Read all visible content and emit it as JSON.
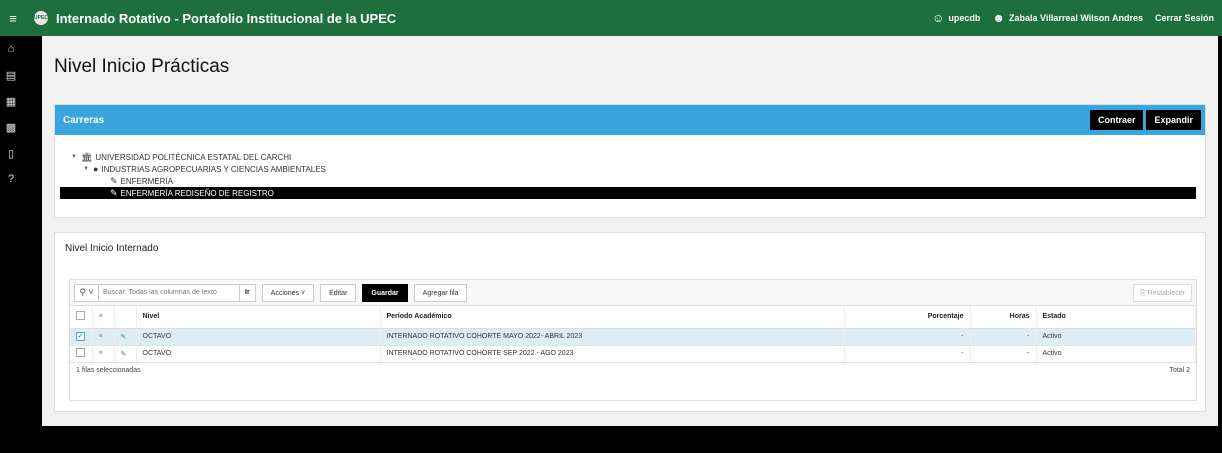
{
  "header": {
    "title": "Internado Rotativo - Portafolio Institucional de la UPEC",
    "logo_text": "UPEC",
    "user": "upecdb",
    "full_name": "Zabala Villarreal Wilson Andres",
    "logout": "Cerrar Sesión"
  },
  "sidebar": {
    "items": [
      {
        "icon": "home-icon",
        "glyph": "⌂"
      },
      {
        "icon": "list-icon",
        "glyph": "▤"
      },
      {
        "icon": "report-icon",
        "glyph": "▦"
      },
      {
        "icon": "report-star-icon",
        "glyph": "▩"
      },
      {
        "icon": "document-icon",
        "glyph": "▯"
      },
      {
        "icon": "help-icon",
        "glyph": "?"
      }
    ]
  },
  "page": {
    "title": "Nivel Inicio Prácticas"
  },
  "careers": {
    "title": "Carreras",
    "collapse_label": "Contraer",
    "expand_label": "Expandir",
    "tree": {
      "university": "UNIVERSIDAD POLITÉCNICA ESTATAL DEL CARCHI",
      "faculty": "INDUSTRIAS AGROPECUARIAS Y CIENCIAS AMBIENTALES",
      "career1": "ENFERMERÍA",
      "career2": "ENFERMERÍA REDISEÑO DE REGISTRO"
    }
  },
  "internado": {
    "title": "Nivel Inicio Internado",
    "search_placeholder": "Buscar: Todas las columnas de texto",
    "go_label": "Ir",
    "actions_label": "Acciones",
    "edit_label": "Editar",
    "save_label": "Guardar",
    "add_row_label": "Agregar fila",
    "reset_label": "Restablecer",
    "columns": {
      "nivel": "Nivel",
      "periodo": "Período Académico",
      "porcentaje": "Porcentaje",
      "horas": "Horas",
      "estado": "Estado"
    },
    "rows": [
      {
        "nivel": "OCTAVO",
        "periodo": "INTERNADO ROTATIVO COHORTE MAYO 2022- ABRIL 2023",
        "porcentaje": "-",
        "horas": "-",
        "estado": "Activo",
        "selected": true
      },
      {
        "nivel": "OCTAVO",
        "periodo": "INTERNADO ROTATIVO COHORTE SEP 2022 - AGO 2023",
        "porcentaje": "-",
        "horas": "-",
        "estado": "Activo",
        "selected": false
      }
    ],
    "selected_count": "1 filas seleccionadas",
    "total": "Total 2"
  },
  "colors": {
    "topbar": "#1d6f3c",
    "region_header": "#3aa4dc",
    "selected_row": "#d9eef5"
  }
}
